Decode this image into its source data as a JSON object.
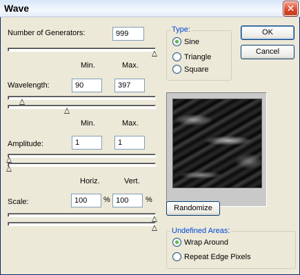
{
  "window": {
    "title": "Wave",
    "close_symbol": "✕"
  },
  "generators": {
    "label": "Number of Generators:",
    "value": "999",
    "slider_fraction": 1.0
  },
  "range_headers_1": {
    "min": "Min.",
    "max": "Max."
  },
  "wavelength": {
    "label": "Wavelength:",
    "min": "90",
    "max": "397",
    "min_slider_fraction": 0.09,
    "max_slider_fraction": 0.4
  },
  "range_headers_2": {
    "min": "Min.",
    "max": "Max."
  },
  "amplitude": {
    "label": "Amplitude:",
    "min": "1",
    "max": "1",
    "min_slider_fraction": 0.0,
    "max_slider_fraction": 0.0
  },
  "scale_headers": {
    "horiz": "Horiz.",
    "vert": "Vert."
  },
  "scale": {
    "label": "Scale:",
    "horiz": "100",
    "vert": "100",
    "unit": "%",
    "horiz_slider_fraction": 1.0,
    "vert_slider_fraction": 1.0
  },
  "type_group": {
    "title": "Type:",
    "options": [
      "Sine",
      "Triangle",
      "Square"
    ],
    "selected": "Sine"
  },
  "buttons": {
    "ok": "OK",
    "cancel": "Cancel",
    "randomize": "Randomize"
  },
  "undefined_areas": {
    "title": "Undefined Areas:",
    "options": [
      "Wrap Around",
      "Repeat Edge Pixels"
    ],
    "selected": "Wrap Around"
  },
  "colors": {
    "dialog_bg": "#ece9d8",
    "group_title": "#0046d5",
    "close_button": "#d9472b"
  }
}
